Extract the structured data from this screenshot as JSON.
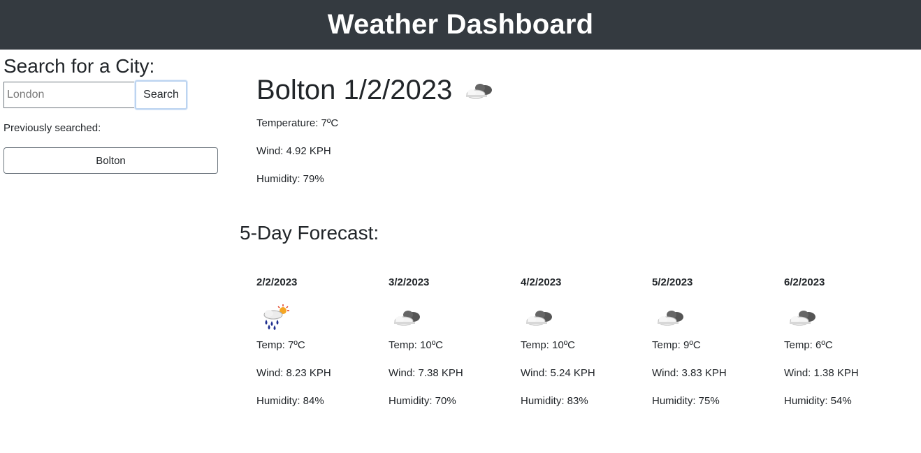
{
  "header": {
    "title": "Weather Dashboard"
  },
  "search": {
    "heading": "Search for a City:",
    "placeholder": "London",
    "button_label": "Search",
    "history_label": "Previously searched:",
    "history": [
      "Bolton"
    ]
  },
  "current": {
    "city": "Bolton",
    "date": "1/2/2023",
    "icon": "cloud-icon",
    "temperature": "Temperature: 7ºC",
    "wind": "Wind: 4.92 KPH",
    "humidity": "Humidity: 79%"
  },
  "forecast": {
    "heading": "5-Day Forecast:",
    "days": [
      {
        "date": "2/2/2023",
        "icon": "rain-sun-icon",
        "temp": "Temp: 7ºC",
        "wind": "Wind: 8.23 KPH",
        "humidity": "Humidity: 84%"
      },
      {
        "date": "3/2/2023",
        "icon": "cloud-icon",
        "temp": "Temp: 10ºC",
        "wind": "Wind: 7.38 KPH",
        "humidity": "Humidity: 70%"
      },
      {
        "date": "4/2/2023",
        "icon": "cloud-icon",
        "temp": "Temp: 10ºC",
        "wind": "Wind: 5.24 KPH",
        "humidity": "Humidity: 83%"
      },
      {
        "date": "5/2/2023",
        "icon": "cloud-icon",
        "temp": "Temp: 9ºC",
        "wind": "Wind: 3.83 KPH",
        "humidity": "Humidity: 75%"
      },
      {
        "date": "6/2/2023",
        "icon": "cloud-icon",
        "temp": "Temp: 6ºC",
        "wind": "Wind: 1.38 KPH",
        "humidity": "Humidity: 54%"
      }
    ]
  }
}
